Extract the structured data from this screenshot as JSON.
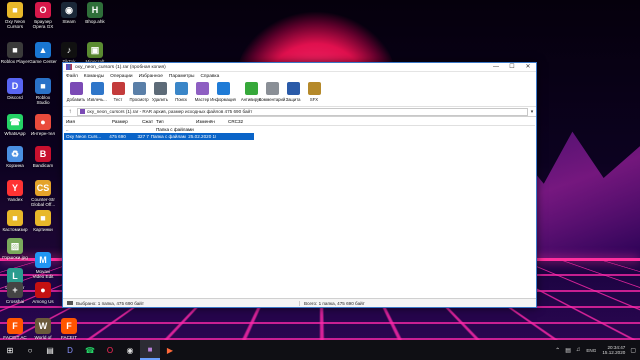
{
  "desktop": {
    "icons": [
      {
        "label": "Oxy Neon\nCursors",
        "icon": "folder-icon",
        "color": "#e8b82a",
        "glyph": "■"
      },
      {
        "label": "Браузер\nOpera GX",
        "icon": "opera-gx-icon",
        "color": "#d8184a",
        "glyph": "O"
      },
      {
        "label": "Steam",
        "icon": "steam-icon",
        "color": "#1b2838",
        "glyph": "◉"
      },
      {
        "label": "Bhop.ahk",
        "icon": "ahk-script-icon",
        "color": "#2f6f3a",
        "glyph": "H"
      },
      {
        "label": "Roblox Player",
        "icon": "roblox-icon",
        "color": "#3a3a3a",
        "glyph": "■"
      },
      {
        "label": "Game Center",
        "icon": "game-center-icon",
        "color": "#1976d2",
        "glyph": "▲"
      },
      {
        "label": "TikTok",
        "icon": "tiktok-icon",
        "color": "#111111",
        "glyph": "♪"
      },
      {
        "label": "Minecraft\nLauncher",
        "icon": "minecraft-icon",
        "color": "#5b8c32",
        "glyph": "▣"
      },
      {
        "label": "Discord",
        "icon": "discord-icon",
        "color": "#5865f2",
        "glyph": "D"
      },
      {
        "label": "Roblox\nStudio",
        "icon": "roblox-studio-icon",
        "color": "#2a72c8",
        "glyph": "■"
      },
      {
        "label": "WhatsApp",
        "icon": "whatsapp-icon",
        "color": "#25d366",
        "glyph": "☎"
      },
      {
        "label": "Интерн-тел",
        "icon": "browser-icon",
        "color": "#e94b3c",
        "glyph": "●"
      },
      {
        "label": "Корзина",
        "icon": "recycle-bin-icon",
        "color": "#4a90e2",
        "glyph": "♻"
      },
      {
        "label": "Bandicam",
        "icon": "bandicam-icon",
        "color": "#c8102e",
        "glyph": "B"
      },
      {
        "label": "Yandex",
        "icon": "yandex-icon",
        "color": "#ff3333",
        "glyph": "Y"
      },
      {
        "label": "Counter-Str\nGlobal Off...",
        "icon": "csgo-icon",
        "color": "#e4a32a",
        "glyph": "CS"
      },
      {
        "label": "Кастомизир",
        "icon": "folder-icon",
        "color": "#e8b82a",
        "glyph": "■"
      },
      {
        "label": "Картинки",
        "icon": "pictures-folder-icon",
        "color": "#e8b82a",
        "glyph": "■"
      },
      {
        "label": "Горшоки.jpg",
        "icon": "image-file-icon",
        "color": "#7aa95c",
        "glyph": "▨"
      },
      {
        "label": "Launcher",
        "icon": "launcher-icon",
        "color": "#2a9d8f",
        "glyph": "L"
      },
      {
        "label": "Movavi\nVideo Edit",
        "icon": "movavi-icon",
        "color": "#2196f3",
        "glyph": "M"
      },
      {
        "label": "Crosshai",
        "icon": "crosshair-icon",
        "color": "#444444",
        "glyph": "+"
      },
      {
        "label": "Among Us",
        "icon": "among-us-icon",
        "color": "#c51111",
        "glyph": "●"
      },
      {
        "label": "FACEIT AC",
        "icon": "faceit-ac-icon",
        "color": "#ff5500",
        "glyph": "F"
      },
      {
        "label": "World of\nTanks Bl...",
        "icon": "world-of-tanks-icon",
        "color": "#6b5a3a",
        "glyph": "W"
      },
      {
        "label": "FACEIT",
        "icon": "faceit-icon",
        "color": "#ff5500",
        "glyph": "F"
      }
    ]
  },
  "window": {
    "title": "oxy_neon_cursors (1).rar (пробная копия)",
    "min": "—",
    "max": "☐",
    "close": "✕",
    "menu": [
      "Файл",
      "Команды",
      "Операции",
      "Избранное",
      "Параметры",
      "Справка"
    ],
    "toolbar": [
      {
        "label": "Добавить",
        "icon": "add-archive-icon",
        "color": "#7b4ab5"
      },
      {
        "label": "Извлечь...",
        "icon": "extract-icon",
        "color": "#2f76c9"
      },
      {
        "label": "Тест",
        "icon": "test-icon",
        "color": "#c33b3b"
      },
      {
        "label": "Просмотр",
        "icon": "view-icon",
        "color": "#5a7fa8"
      },
      {
        "label": "Удалить",
        "icon": "delete-icon",
        "color": "#5d6b78"
      },
      {
        "label": "Поиск",
        "icon": "find-icon",
        "color": "#3a86c8"
      },
      {
        "label": "Мастер",
        "icon": "wizard-icon",
        "color": "#8e5fc2"
      },
      {
        "label": "Информация",
        "icon": "info-icon",
        "color": "#1f7bd6"
      },
      {
        "label": "Антивирус",
        "icon": "antivirus-icon",
        "color": "#36a83a"
      },
      {
        "label": "Комментарий",
        "icon": "comment-icon",
        "color": "#8a8f96"
      },
      {
        "label": "Защита",
        "icon": "protect-icon",
        "color": "#2a5aa8"
      },
      {
        "label": "SFX",
        "icon": "sfx-icon",
        "color": "#b5892a"
      }
    ],
    "address": "oxy_neon_cursors (1).rar - RAR архив, размер исходных файлов 475 690 байт",
    "columns": [
      "Имя",
      "Размер",
      "Сжат",
      "Тип",
      "Изменён",
      "CRC32"
    ],
    "rows": [
      {
        "name": "..",
        "size": "",
        "packed": "",
        "type": "Папка с файлами",
        "modified": "",
        "crc": "",
        "selected": false
      },
      {
        "name": "Oxy Neon Curs...",
        "size": "475 690",
        "packed": "327 750",
        "type": "Папка с файлами",
        "modified": "25.02.2020 18:...",
        "crc": "",
        "selected": true
      }
    ],
    "status_left": "Выбрано: 1 папка, 475 690 байт",
    "status_right": "Всего: 1 папка, 475 690 байт"
  },
  "taskbar": {
    "items": [
      {
        "icon": "start-icon",
        "glyph": "⊞",
        "color": "#ffffff"
      },
      {
        "icon": "search-icon",
        "glyph": "○",
        "color": "#ffffff"
      },
      {
        "icon": "task-view-icon",
        "glyph": "▤",
        "color": "#ffffff"
      },
      {
        "icon": "discord-taskbar-icon",
        "glyph": "D",
        "color": "#8a93ff"
      },
      {
        "icon": "whatsapp-taskbar-icon",
        "glyph": "☎",
        "color": "#25d366"
      },
      {
        "icon": "opera-gx-taskbar-icon",
        "glyph": "O",
        "color": "#ff2a5a"
      },
      {
        "icon": "obs-taskbar-icon",
        "glyph": "◉",
        "color": "#dddddd"
      },
      {
        "icon": "winrar-taskbar-icon",
        "glyph": "■",
        "color": "#b57fd6",
        "active": true
      },
      {
        "icon": "media-taskbar-icon",
        "glyph": "▶",
        "color": "#ff6a3a"
      }
    ],
    "lang": "ENG",
    "time": "20:34:47",
    "date": "15.12.2020"
  }
}
